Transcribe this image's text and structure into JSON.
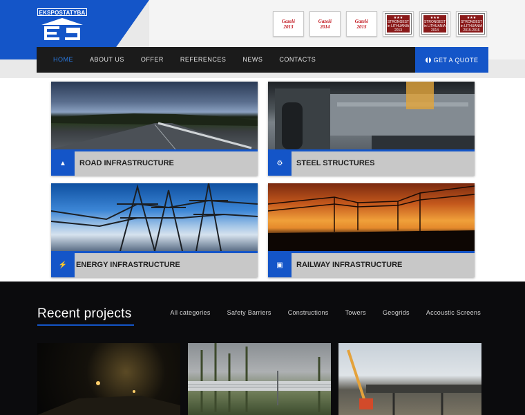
{
  "brand": {
    "logo_text": "EKSPOSTATYBA",
    "logo_mark": "ES"
  },
  "awards": [
    {
      "type": "gazele",
      "brand": "Gazelė",
      "year": "2013"
    },
    {
      "type": "gazele",
      "brand": "Gazelė",
      "year": "2014"
    },
    {
      "type": "gazele",
      "brand": "Gazelė",
      "year": "2015"
    },
    {
      "type": "strongest",
      "line1": "STRONGEST",
      "line2": "in LITHUANIA",
      "years": "2013"
    },
    {
      "type": "strongest",
      "line1": "STRONGEST",
      "line2": "in LITHUANIA",
      "years": "2014"
    },
    {
      "type": "strongest",
      "line1": "STRONGEST",
      "line2": "in LITHUANIA",
      "years": "2015-2016"
    }
  ],
  "nav": {
    "items": [
      {
        "label": "HOME",
        "active": true
      },
      {
        "label": "ABOUT US",
        "active": false
      },
      {
        "label": "OFFER",
        "active": false
      },
      {
        "label": "REFERENCES",
        "active": false
      },
      {
        "label": "NEWS",
        "active": false
      },
      {
        "label": "CONTACTS",
        "active": false
      }
    ],
    "quote_label": "GET A QUOTE",
    "quote_icon": "globe-icon"
  },
  "services": [
    {
      "label": "ROAD INFRASTRUCTURE",
      "icon": "road-icon"
    },
    {
      "label": "STEEL STRUCTURES",
      "icon": "gear-icon"
    },
    {
      "label": "ENERGY INFRASTRUCTURE",
      "icon": "lightning-icon"
    },
    {
      "label": "RAILWAY INFRASTRUCTURE",
      "icon": "train-icon"
    }
  ],
  "recent": {
    "title": "Recent projects",
    "filters": [
      "All categories",
      "Safety Barriers",
      "Constructions",
      "Towers",
      "Geogrids",
      "Accoustic Screens"
    ]
  },
  "colors": {
    "accent": "#1455c8",
    "nav_bg": "#1b1b1b",
    "dark_section": "#0b0b0d"
  }
}
